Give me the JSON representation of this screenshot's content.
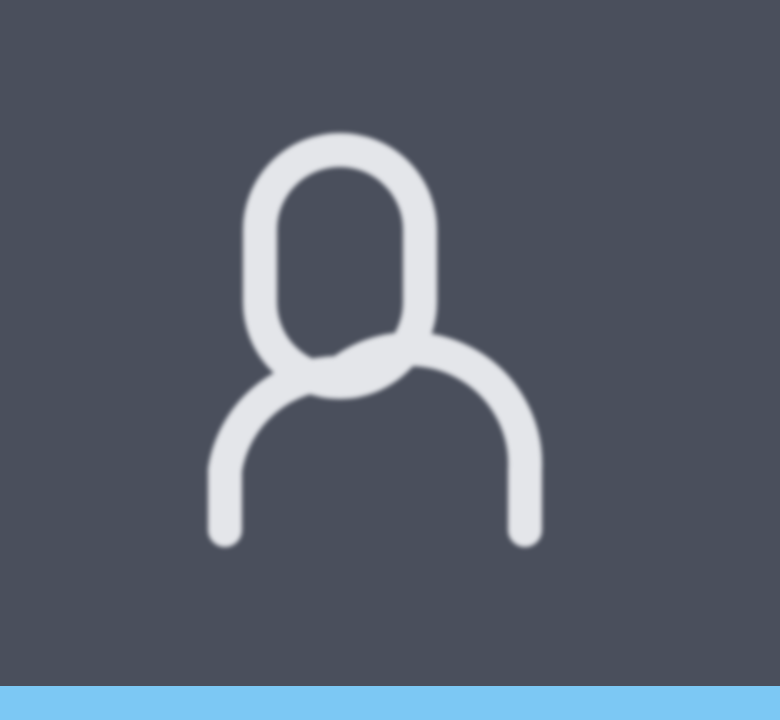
{
  "account_tab": {
    "icon": "user-icon",
    "active": true
  },
  "colors": {
    "background": "#4a4f5c",
    "icon_stroke": "#e4e6ea",
    "active_indicator": "#7cc8f4"
  }
}
